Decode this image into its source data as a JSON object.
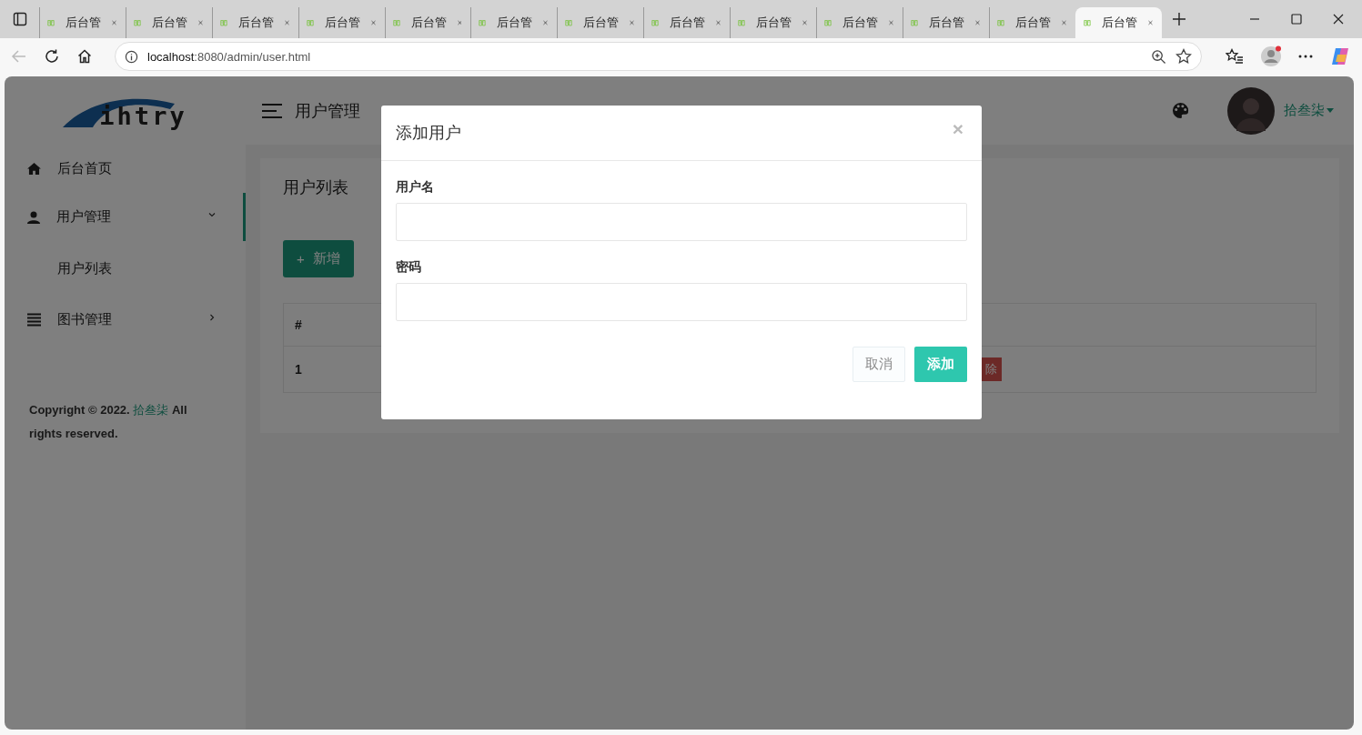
{
  "browser": {
    "tabs": [
      {
        "title": "后台管",
        "selected": false
      },
      {
        "title": "后台管",
        "selected": false
      },
      {
        "title": "后台管",
        "selected": false
      },
      {
        "title": "后台管",
        "selected": false
      },
      {
        "title": "后台管",
        "selected": false
      },
      {
        "title": "后台管",
        "selected": false
      },
      {
        "title": "后台管",
        "selected": false
      },
      {
        "title": "后台管",
        "selected": false
      },
      {
        "title": "后台管",
        "selected": false
      },
      {
        "title": "后台管",
        "selected": false
      },
      {
        "title": "后台管",
        "selected": false
      },
      {
        "title": "后台管",
        "selected": false
      },
      {
        "title": "后台管",
        "selected": true
      }
    ],
    "url_host": "localhost",
    "url_path": ":8080/admin/user.html"
  },
  "app": {
    "logo": "ihtry",
    "header": {
      "title": "用户管理",
      "user": "拾叁柒"
    },
    "sidebar": {
      "items": [
        {
          "label": "后台首页",
          "selected": false
        },
        {
          "label": "用户管理",
          "selected": true,
          "expanded": true,
          "children": [
            {
              "label": "用户列表"
            }
          ]
        },
        {
          "label": "图书管理",
          "selected": false,
          "expanded": false
        }
      ],
      "copyright": {
        "prefix": "Copyright © 2022.",
        "link": "拾叁柒",
        "suffix": "All rights reserved."
      }
    },
    "content": {
      "title": "用户列表",
      "add_button": {
        "icon": "+",
        "label": "新增"
      },
      "table": {
        "columns": [
          "#"
        ],
        "rows": [
          {
            "cells": [
              "1"
            ],
            "action": "除"
          }
        ]
      }
    }
  },
  "modal": {
    "title": "添加用户",
    "close": "×",
    "fields": [
      {
        "label": "用户名"
      },
      {
        "label": "密码"
      }
    ],
    "buttons": [
      {
        "label": "取消",
        "kind": "secondary"
      },
      {
        "label": "添加",
        "kind": "primary"
      }
    ]
  }
}
